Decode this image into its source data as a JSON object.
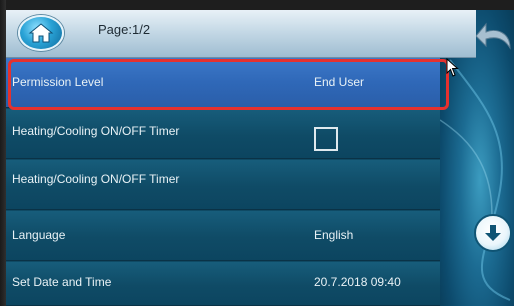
{
  "header": {
    "page_label": "Page:1/2",
    "home_icon": "home-icon",
    "back_icon": "back-arrow-icon"
  },
  "settings": {
    "rows": [
      {
        "label": "Permission Level",
        "value": "End User",
        "selected": true
      },
      {
        "label": "Heating/Cooling ON/OFF Timer",
        "control": "checkbox",
        "checked": false
      },
      {
        "label": "Heating/Cooling ON/OFF Timer",
        "value": ""
      },
      {
        "label": "Language",
        "value": "English"
      },
      {
        "label": "Set Date and Time",
        "value": "20.7.2018 09:40"
      }
    ]
  },
  "navigation": {
    "scroll_down_icon": "arrow-down-icon"
  },
  "colors": {
    "selected_row": "#2f68b8",
    "selection_outline": "#e5312e",
    "row_background": "#0f4b66",
    "header": "#c5d9e6"
  }
}
